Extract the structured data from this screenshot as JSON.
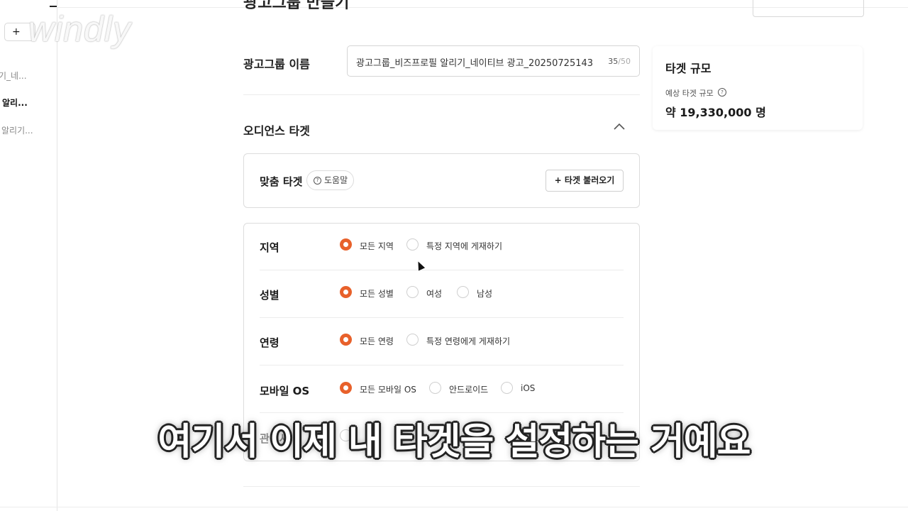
{
  "watermark": "windly",
  "sidebar": {
    "add_label": "+ ",
    "items": [
      {
        "label": "기_네..."
      },
      {
        "label": "알리..."
      },
      {
        "label": "알리기..."
      }
    ]
  },
  "page": {
    "title": "광고그룹 만들기",
    "top_button": ""
  },
  "adgroup_name": {
    "label": "광고그룹 이름",
    "value": "광고그룹_비즈프로필 알리기_네이티브 광고_20250725143",
    "count": "35",
    "max": "/50"
  },
  "audience": {
    "section_title": "오디언스 타겟",
    "custom_target_label": "맞춤 타겟",
    "help_label": "도움말",
    "load_target_label": "+ 타겟 불러오기",
    "rows": {
      "region": {
        "label": "지역",
        "options": [
          "모든 지역",
          "특정 지역에 게재하기"
        ]
      },
      "gender": {
        "label": "성별",
        "options": [
          "모든 성별",
          "여성",
          "남성"
        ]
      },
      "age": {
        "label": "연령",
        "options": [
          "모든 연령",
          "특정 연령에게 게재하기"
        ]
      },
      "os": {
        "label": "모바일 OS",
        "options": [
          "모든 모바일 OS",
          "안드로이드",
          "iOS"
        ]
      },
      "interest": {
        "label": "관심사"
      }
    }
  },
  "target_size": {
    "title": "타겟 규모",
    "sub": "예상 타겟 규모",
    "value": "약 19,330,000 명"
  },
  "subtitle": "여기서 이제 내 타겟을 설정하는 거예요",
  "colors": {
    "accent": "#e8612b"
  }
}
